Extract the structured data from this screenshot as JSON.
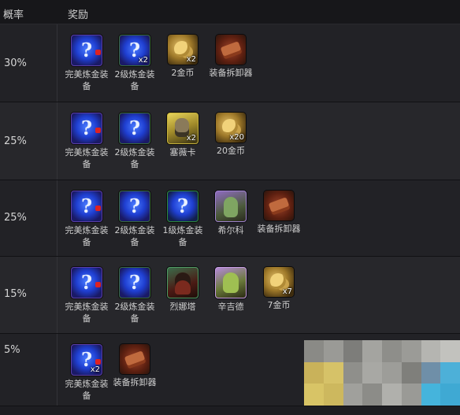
{
  "header": {
    "probability": "概率",
    "reward": "奖励"
  },
  "rows": [
    {
      "probability": "30%",
      "items": [
        {
          "icon": "perfect-alchemy-equipment-icon",
          "badge": "",
          "label": "完美炼金装备"
        },
        {
          "icon": "level-2-alchemy-equipment-icon",
          "badge": "x2",
          "label": "2级炼金装备"
        },
        {
          "icon": "gold-coin-icon",
          "badge": "x2",
          "label": "2金币"
        },
        {
          "icon": "equipment-dismantler-icon",
          "badge": "",
          "label": "装备拆卸器"
        }
      ]
    },
    {
      "probability": "25%",
      "items": [
        {
          "icon": "perfect-alchemy-equipment-icon",
          "badge": "",
          "label": "完美炼金装备"
        },
        {
          "icon": "level-2-alchemy-equipment-icon",
          "badge": "",
          "label": "2级炼金装备"
        },
        {
          "icon": "cassie-card-icon",
          "badge": "x2",
          "label": "塞薇卡"
        },
        {
          "icon": "gold-coin-icon",
          "badge": "x20",
          "label": "20金币"
        }
      ]
    },
    {
      "probability": "25%",
      "items": [
        {
          "icon": "perfect-alchemy-equipment-icon",
          "badge": "",
          "label": "完美炼金装备"
        },
        {
          "icon": "level-2-alchemy-equipment-icon",
          "badge": "",
          "label": "2级炼金装备"
        },
        {
          "icon": "level-1-alchemy-equipment-icon",
          "badge": "",
          "label": "1级炼金装备"
        },
        {
          "icon": "xierke-hero-icon",
          "badge": "",
          "label": "希尔科"
        },
        {
          "icon": "equipment-dismantler-icon",
          "badge": "",
          "label": "装备拆卸器"
        }
      ]
    },
    {
      "probability": "15%",
      "items": [
        {
          "icon": "perfect-alchemy-equipment-icon",
          "badge": "",
          "label": "完美炼金装备"
        },
        {
          "icon": "level-2-alchemy-equipment-icon",
          "badge": "",
          "label": "2级炼金装备"
        },
        {
          "icon": "lienata-hero-icon",
          "badge": "",
          "label": "烈娜塔"
        },
        {
          "icon": "xinjide-hero-icon",
          "badge": "",
          "label": "辛吉德"
        },
        {
          "icon": "gold-coin-icon",
          "badge": "x7",
          "label": "7金币"
        }
      ]
    },
    {
      "probability": "5%",
      "items": [
        {
          "icon": "perfect-alchemy-equipment-icon",
          "badge": "x2",
          "label": "完美炼金装备"
        },
        {
          "icon": "equipment-dismantler-icon",
          "badge": "",
          "label": "装备拆卸器"
        }
      ]
    }
  ],
  "watermark_colors": [
    "#8a8a86",
    "#9a9a96",
    "#7d7d7a",
    "#a4a4a0",
    "#8e8e8a",
    "#9b9b97",
    "#b5b5b1",
    "#c2c2be",
    "#c9b25a",
    "#d6c268",
    "#8f8f8b",
    "#a8a8a4",
    "#9d9d99",
    "#7f7f7b",
    "#6f8fa8",
    "#4db0d8",
    "#d8c466",
    "#cdb85e",
    "#a0a09c",
    "#8c8c88",
    "#b0b0ac",
    "#9a9a96",
    "#45b4dc",
    "#3fa9d3"
  ]
}
